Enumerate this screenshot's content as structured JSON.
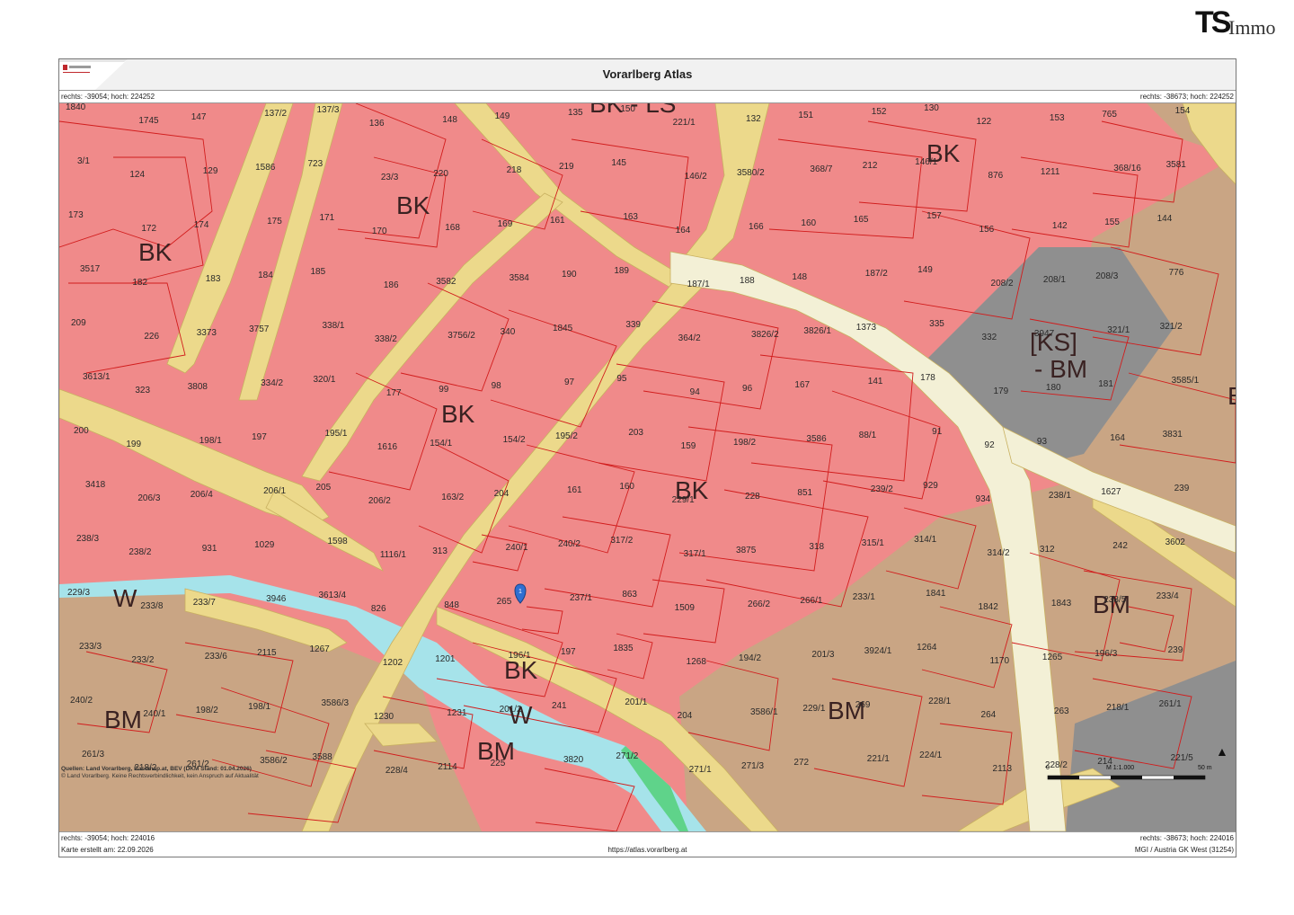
{
  "brand": {
    "name_ts": "TS",
    "name_immo": "Immo"
  },
  "header": {
    "title": "Vorarlberg Atlas"
  },
  "coords": {
    "top_left": "rechts: -39054; hoch: 224252",
    "top_right": "rechts: -38673; hoch: 224252",
    "bottom_left": "rechts: -39054; hoch: 224016",
    "bottom_right": "rechts: -38673; hoch: 224016"
  },
  "footer": {
    "created": "Karte erstellt am: 22.09.2026",
    "url": "https://atlas.vorarlberg.at",
    "crs": "MGI / Austria GK West (31254)"
  },
  "sources": {
    "line1": "Quellen: Land Vorarlberg, Basemap.at, BEV (DKM Stand: 01.04.2026)",
    "line2": "© Land Vorarlberg. Keine Rechtsverbindlichkeit, kein Anspruch auf Aktualität"
  },
  "scale": {
    "label": "M 1:1.000",
    "start": "0",
    "end": "50 m"
  },
  "colors": {
    "bk_zone": "#f08a8a",
    "bm_zone": "#c9a584",
    "ks_zone": "#8f8f8f",
    "water": "#a6e3ea",
    "road": "#ecd98b",
    "main_road": "#f3f0d6",
    "parcel_line": "#d11c1c",
    "marker": "#2f6fd1"
  },
  "map": {
    "zones": [
      {
        "label": "BK"
      },
      {
        "label": "BK"
      },
      {
        "label": "BK"
      },
      {
        "label": "BK"
      },
      {
        "label": "BK"
      },
      {
        "label": "BK"
      },
      {
        "label": "BK"
      },
      {
        "label": "BM"
      },
      {
        "label": "BM"
      },
      {
        "label": "BM"
      },
      {
        "label": "BM"
      },
      {
        "label": "[KS]"
      },
      {
        "label": "- BM"
      },
      {
        "label": "W"
      },
      {
        "label": "W"
      },
      {
        "label": "BK - LS"
      },
      {
        "label": "B"
      }
    ],
    "parcels": [
      "1840",
      "1745",
      "147",
      "137/2",
      "137/3",
      "136",
      "148",
      "149",
      "135",
      "150",
      "221/1",
      "132",
      "151",
      "152",
      "130",
      "122",
      "153",
      "765",
      "154",
      "3/1",
      "124",
      "129",
      "1586",
      "723",
      "23/3",
      "220",
      "218",
      "219",
      "145",
      "146/2",
      "3580/2",
      "368/7",
      "212",
      "146/1",
      "876",
      "1211",
      "368/16",
      "3581",
      "173",
      "172",
      "174",
      "175",
      "171",
      "170",
      "168",
      "169",
      "161",
      "163",
      "164",
      "166",
      "160",
      "165",
      "157",
      "156",
      "142",
      "155",
      "144",
      "3517",
      "182",
      "183",
      "184",
      "185",
      "186",
      "3582",
      "3584",
      "190",
      "189",
      "187/1",
      "188",
      "148",
      "187/2",
      "149",
      "208/2",
      "208/1",
      "208/3",
      "776",
      "209",
      "226",
      "3373",
      "3757",
      "338/1",
      "338/2",
      "3756/2",
      "340",
      "1845",
      "339",
      "364/2",
      "3826/2",
      "3826/1",
      "1373",
      "335",
      "332",
      "3947",
      "321/1",
      "321/2",
      "3613/1",
      "323",
      "3808",
      "334/2",
      "320/1",
      "177",
      "99",
      "98",
      "97",
      "95",
      "94",
      "96",
      "167",
      "141",
      "178",
      "179",
      "180",
      "181",
      "3585/1",
      "200",
      "199",
      "198/1",
      "197",
      "195/1",
      "1616",
      "154/1",
      "154/2",
      "195/2",
      "203",
      "159",
      "198/2",
      "3586",
      "88/1",
      "91",
      "92",
      "93",
      "164",
      "3831",
      "3418",
      "206/3",
      "206/4",
      "206/1",
      "205",
      "206/2",
      "163/2",
      "204",
      "161",
      "160",
      "229/1",
      "228",
      "851",
      "239/2",
      "929",
      "934",
      "238/1",
      "1627",
      "239",
      "238/3",
      "238/2",
      "931",
      "1029",
      "1598",
      "1116/1",
      "313",
      "240/1",
      "240/2",
      "317/2",
      "317/1",
      "3875",
      "318",
      "315/1",
      "314/1",
      "314/2",
      "312",
      "242",
      "3602",
      "229/3",
      "233/8",
      "233/7",
      "3946",
      "3613/4",
      "826",
      "848",
      "265",
      "237/1",
      "863",
      "1509",
      "266/2",
      "266/1",
      "233/1",
      "1841",
      "1842",
      "1843",
      "233/5",
      "233/4",
      "233/3",
      "233/2",
      "233/6",
      "2115",
      "1267",
      "1202",
      "1201",
      "196/1",
      "197",
      "1835",
      "1268",
      "194/2",
      "201/3",
      "3924/1",
      "1264",
      "1170",
      "1265",
      "196/3",
      "239",
      "240/2",
      "240/1",
      "198/2",
      "198/1",
      "3586/3",
      "1230",
      "1231",
      "201/2",
      "241",
      "201/1",
      "204",
      "3586/1",
      "229/1",
      "269",
      "228/1",
      "264",
      "263",
      "218/1",
      "261/1",
      "261/3",
      "218/2",
      "261/2",
      "3586/2",
      "3588",
      "228/4",
      "2114",
      "225",
      "3820",
      "271/2",
      "271/1",
      "271/3",
      "272",
      "221/1",
      "224/1",
      "2113",
      "228/2",
      "214",
      "221/5"
    ]
  }
}
